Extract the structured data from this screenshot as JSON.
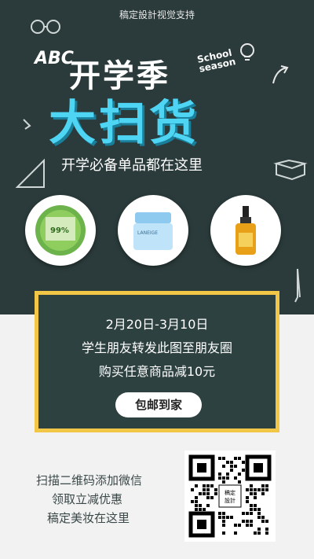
{
  "header": {
    "credit": "稿定設計视觉支持"
  },
  "hero": {
    "title_line1": "开学季",
    "season_line1": "School",
    "season_line2": "season",
    "title_line2": "大扫货",
    "subtitle": "开学必备单品都在这里",
    "doodle_abc": "ABC"
  },
  "products": [
    {
      "name": "aloe-gel-jar",
      "label": "99%"
    },
    {
      "name": "laneige-cream-jar",
      "label": "LANEIGE"
    },
    {
      "name": "hair-serum-bottle",
      "label": ""
    }
  ],
  "promo": {
    "date_range": "2月20日-3月10日",
    "line2": "学生朋友转发此图至朋友圈",
    "line3": "购买任意商品减10元",
    "button": "包邮到家"
  },
  "footer": {
    "line1": "扫描二维码添加微信",
    "line2": "领取立减优惠",
    "line3": "稿定美妆在这里",
    "qr_center": "稿定\n設計"
  },
  "colors": {
    "board": "#2b3b3b",
    "accent_cyan": "#4fd5f4",
    "frame_gold": "#f2c646"
  }
}
